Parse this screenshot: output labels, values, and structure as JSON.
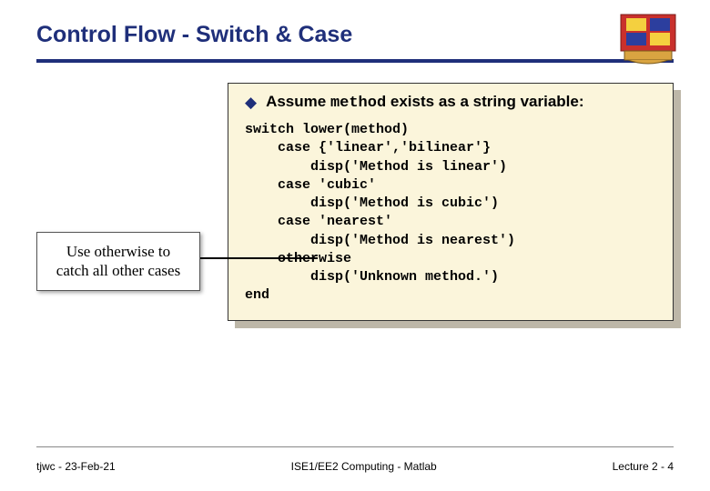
{
  "header": {
    "title": "Control Flow -  Switch & Case"
  },
  "assume": {
    "prefix": "Assume ",
    "method": "method",
    "suffix": " exists as a string variable:"
  },
  "code": "switch lower(method)\n    case {'linear','bilinear'}\n        disp('Method is linear')\n    case 'cubic'\n        disp('Method is cubic')\n    case 'nearest'\n        disp('Method is nearest')\n    otherwise\n        disp('Unknown method.')\nend",
  "callout": {
    "line1": "Use otherwise to",
    "line2": "catch all other cases"
  },
  "footer": {
    "left": "tjwc - 23-Feb-21",
    "center": "ISE1/EE2 Computing - Matlab",
    "right": "Lecture 2 - 4"
  }
}
